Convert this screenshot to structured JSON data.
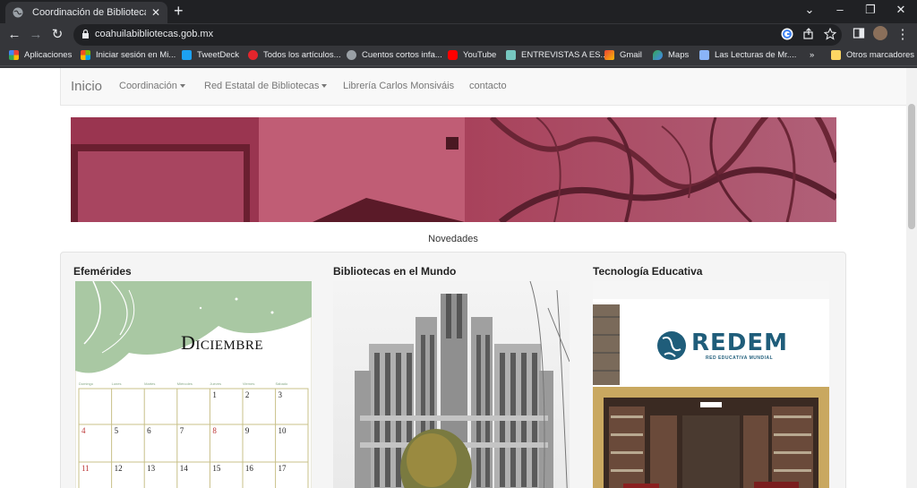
{
  "browser": {
    "tab_title": "Coordinación de Bibliotecas Coahuila",
    "url": "coahuilabibliotecas.gob.mx"
  },
  "bookmarks": [
    {
      "label": "Aplicaciones",
      "icon": "apps-grid-icon",
      "color": "#e8453c"
    },
    {
      "label": "Iniciar sesión en Mi...",
      "icon": "microsoft-icon",
      "color": "#f25022"
    },
    {
      "label": "TweetDeck",
      "icon": "tweetdeck-icon",
      "color": "#1da1f2"
    },
    {
      "label": "Todos los artículos...",
      "icon": "d-icon",
      "color": "#e4252c"
    },
    {
      "label": "Cuentos cortos infa...",
      "icon": "globe-icon",
      "color": "#9aa0a6"
    },
    {
      "label": "YouTube",
      "icon": "youtube-icon",
      "color": "#ff0000"
    },
    {
      "label": "ENTREVISTAS A ES...",
      "icon": "bookmark-site-icon",
      "color": "#76c7c0"
    },
    {
      "label": "Gmail",
      "icon": "gmail-icon",
      "color": "#ea4335"
    },
    {
      "label": "Maps",
      "icon": "maps-icon",
      "color": "#34a853"
    },
    {
      "label": "Las Lecturas de Mr....",
      "icon": "bookmark-site-icon",
      "color": "#8ab4f8"
    }
  ],
  "bookmarks_other": "Otros marcadores",
  "site": {
    "nav": {
      "home": "Inicio",
      "coordinacion": "Coordinación",
      "red_estatal": "Red Estatal de Bibliotecas",
      "libreria": "Librería Carlos Monsiváis",
      "contacto": "contacto"
    },
    "novedades": "Novedades",
    "sections": [
      {
        "title": "Efemérides"
      },
      {
        "title": "Bibliotecas en el Mundo"
      },
      {
        "title": "Tecnología Educativa"
      }
    ],
    "calendar": {
      "month": "Diciembre",
      "weekdays": [
        "Domingo",
        "Lunes",
        "Martes",
        "Miércoles",
        "Jueves",
        "Viernes",
        "Sábado"
      ],
      "rows": [
        [
          "",
          "",
          "",
          "",
          "1",
          "2",
          "3"
        ],
        [
          "4",
          "5",
          "6",
          "7",
          "8",
          "9",
          "10"
        ],
        [
          "11",
          "12",
          "13",
          "14",
          "15",
          "16",
          "17"
        ]
      ]
    },
    "redem": {
      "logo": "REDEM",
      "tagline": "RED EDUCATIVA MUNDIAL"
    }
  },
  "colors": {
    "banner": "#a8415a",
    "calendar_green": "#6f9a60",
    "redem_blue": "#1f5d7a",
    "frame_gold": "#c9a860"
  }
}
